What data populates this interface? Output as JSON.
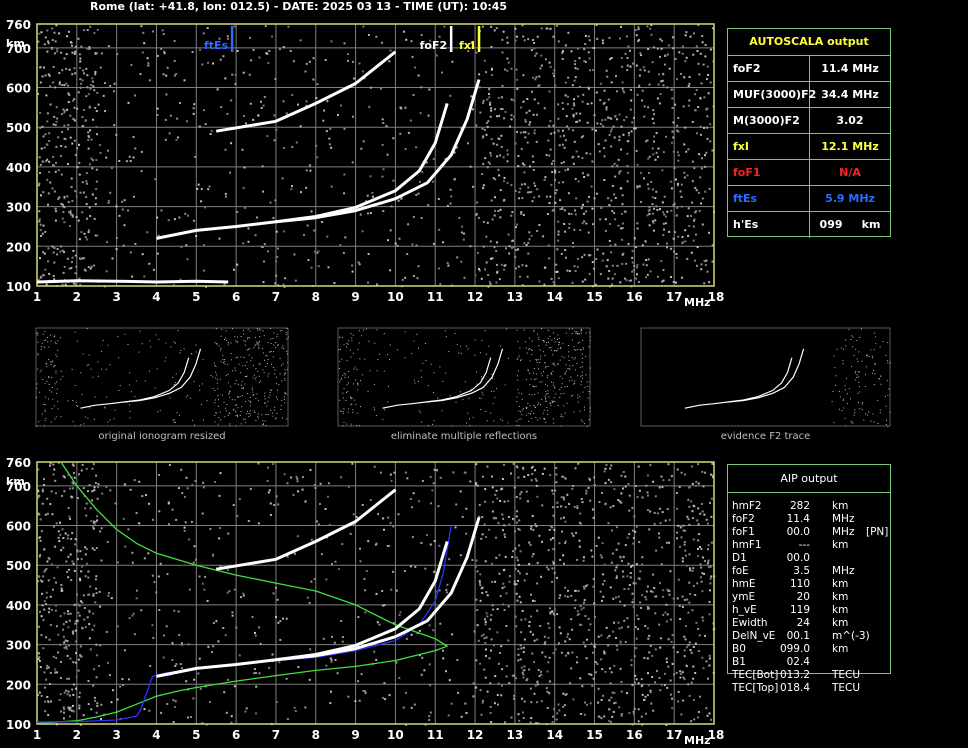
{
  "header": "Rome (lat: +41.8, lon: 012.5) - DATE: 2025 03 13 - TIME (UT): 10:45",
  "colors": {
    "grid": "#7f7f7f",
    "frame": "#d7d77a",
    "green": "#3fe03f",
    "blue": "#3030ff",
    "yellow": "#ffff3c",
    "red": "#ff2020",
    "es": "#2a6cff",
    "tblborder": "#7dc47d"
  },
  "chart_data": [
    {
      "type": "scatter",
      "title": "",
      "xlabel": "MHz",
      "ylabel": "km",
      "xlim": [
        1,
        18
      ],
      "ylim": [
        100,
        760
      ],
      "xticks": [
        "1",
        "2",
        "3",
        "4",
        "5",
        "6",
        "7",
        "8",
        "9",
        "10",
        "11",
        "12",
        "13",
        "14",
        "15",
        "16",
        "17",
        "18"
      ],
      "yticks": [
        "100",
        "200",
        "300",
        "400",
        "500",
        "600",
        "700",
        "760"
      ],
      "markers": [
        {
          "label": "ftEs",
          "x": 5.9,
          "color": "#2a6cff"
        },
        {
          "label": "foF2",
          "x": 11.4,
          "color": "#ffffff"
        },
        {
          "label": "fxI",
          "x": 12.1,
          "color": "#ffff3c"
        }
      ],
      "series": [
        {
          "values": [
            [
              4.0,
              220
            ],
            [
              5.0,
              240
            ],
            [
              6.0,
              250
            ],
            [
              7.0,
              262
            ],
            [
              8.0,
              275
            ],
            [
              9.0,
              298
            ],
            [
              10.0,
              340
            ],
            [
              10.6,
              390
            ],
            [
              11.0,
              460
            ],
            [
              11.3,
              560
            ]
          ],
          "color": "#ffffff"
        },
        {
          "values": [
            [
              7.0,
              262
            ],
            [
              8.0,
              272
            ],
            [
              9.0,
              290
            ],
            [
              10.0,
              320
            ],
            [
              10.8,
              360
            ],
            [
              11.4,
              430
            ],
            [
              11.8,
              520
            ],
            [
              12.1,
              620
            ]
          ],
          "color": "#ffffff"
        },
        {
          "values": [
            [
              5.5,
              490
            ],
            [
              7.0,
              515
            ],
            [
              8.0,
              560
            ],
            [
              9.0,
              610
            ],
            [
              10.0,
              690
            ]
          ],
          "color": "#ffffff"
        },
        {
          "values": [
            [
              1.0,
              110
            ],
            [
              2.0,
              113
            ],
            [
              3.0,
              112
            ],
            [
              4.0,
              110
            ],
            [
              5.0,
              112
            ],
            [
              5.8,
              110
            ]
          ],
          "color": "#ffffff"
        }
      ]
    },
    {
      "type": "line",
      "title": "",
      "xlabel": "MHz",
      "ylabel": "km",
      "xlim": [
        1,
        18
      ],
      "ylim": [
        100,
        760
      ],
      "xticks": [
        "1",
        "2",
        "3",
        "4",
        "5",
        "6",
        "7",
        "8",
        "9",
        "10",
        "11",
        "12",
        "13",
        "14",
        "15",
        "16",
        "17",
        "18"
      ],
      "yticks": [
        "100",
        "200",
        "300",
        "400",
        "500",
        "600",
        "700",
        "760"
      ],
      "series": [
        {
          "values": [
            [
              1.6,
              760
            ],
            [
              2.0,
              700
            ],
            [
              2.5,
              640
            ],
            [
              3.0,
              590
            ],
            [
              3.5,
              555
            ],
            [
              4.0,
              530
            ],
            [
              5.0,
              500
            ],
            [
              6.0,
              475
            ],
            [
              7.0,
              455
            ],
            [
              8.0,
              435
            ],
            [
              9.0,
              400
            ],
            [
              10.0,
              350
            ],
            [
              11.0,
              315
            ],
            [
              11.3,
              296
            ],
            [
              11.0,
              285
            ],
            [
              10.0,
              260
            ],
            [
              9.0,
              245
            ],
            [
              8.0,
              235
            ],
            [
              7.0,
              222
            ],
            [
              6.0,
              208
            ],
            [
              5.0,
              192
            ],
            [
              4.5,
              182
            ],
            [
              4.0,
              170
            ],
            [
              3.5,
              150
            ],
            [
              3.0,
              130
            ],
            [
              2.5,
              118
            ],
            [
              2.0,
              108
            ],
            [
              1.0,
              102
            ]
          ],
          "color": "#3fe03f"
        },
        {
          "values": [
            [
              1.0,
              105
            ],
            [
              2.0,
              106
            ],
            [
              3.0,
              110
            ],
            [
              3.5,
              120
            ],
            [
              3.6,
              135
            ],
            [
              3.9,
              220
            ],
            [
              4.2,
              228
            ],
            [
              5.0,
              240
            ],
            [
              6.0,
              250
            ],
            [
              7.0,
              260
            ],
            [
              8.0,
              268
            ],
            [
              9.0,
              285
            ],
            [
              10.0,
              310
            ],
            [
              10.6,
              350
            ],
            [
              11.0,
              410
            ],
            [
              11.2,
              480
            ],
            [
              11.4,
              600
            ]
          ],
          "color": "#3030ff"
        },
        {
          "values": [
            [
              4.0,
              220
            ],
            [
              5.0,
              240
            ],
            [
              6.0,
              250
            ],
            [
              7.0,
              262
            ],
            [
              8.0,
              275
            ],
            [
              9.0,
              298
            ],
            [
              10.0,
              340
            ],
            [
              10.6,
              390
            ],
            [
              11.0,
              460
            ],
            [
              11.3,
              560
            ]
          ],
          "color": "#ffffff"
        },
        {
          "values": [
            [
              7.0,
              262
            ],
            [
              8.0,
              272
            ],
            [
              9.0,
              290
            ],
            [
              10.0,
              320
            ],
            [
              10.8,
              360
            ],
            [
              11.4,
              430
            ],
            [
              11.8,
              520
            ],
            [
              12.1,
              620
            ]
          ],
          "color": "#ffffff"
        },
        {
          "values": [
            [
              5.5,
              490
            ],
            [
              7.0,
              515
            ],
            [
              8.0,
              560
            ],
            [
              9.0,
              610
            ],
            [
              10.0,
              690
            ]
          ],
          "color": "#ffffff"
        }
      ]
    }
  ],
  "thumbnails": [
    {
      "caption": "original ionogram resized"
    },
    {
      "caption": "eliminate multiple reflections"
    },
    {
      "caption": "evidence F2 trace"
    }
  ],
  "autoscala": {
    "title": "AUTOSCALA output",
    "rows": [
      {
        "k": "foF2",
        "v": "11.4 MHz",
        "kc": "#ffffff",
        "vc": "#ffffff"
      },
      {
        "k": "MUF(3000)F2",
        "v": "34.4 MHz",
        "kc": "#ffffff",
        "vc": "#ffffff"
      },
      {
        "k": "M(3000)F2",
        "v": "3.02",
        "kc": "#ffffff",
        "vc": "#ffffff"
      },
      {
        "k": "fxI",
        "v": "12.1 MHz",
        "kc": "#ffff3c",
        "vc": "#ffff3c"
      },
      {
        "k": "foF1",
        "v": "N/A",
        "kc": "#ff2020",
        "vc": "#ff2020"
      },
      {
        "k": "ftEs",
        "v": "5.9 MHz",
        "kc": "#2a6cff",
        "vc": "#2a6cff"
      },
      {
        "k": "h'Es",
        "v": "099     km",
        "kc": "#ffffff",
        "vc": "#ffffff"
      }
    ]
  },
  "aip": {
    "title": "AIP output",
    "rows": [
      {
        "n": "hmF2",
        "v": "282",
        "u": "km",
        "x": ""
      },
      {
        "n": "foF2",
        "v": "11.4",
        "u": "MHz",
        "x": ""
      },
      {
        "n": "foF1",
        "v": "00.0",
        "u": "MHz",
        "x": "[PN]"
      },
      {
        "n": "hmF1",
        "v": "---",
        "u": "km",
        "x": ""
      },
      {
        "n": "D1",
        "v": "00.0",
        "u": "",
        "x": ""
      },
      {
        "n": "foE",
        "v": "3.5",
        "u": "MHz",
        "x": ""
      },
      {
        "n": "hmE",
        "v": "110",
        "u": "km",
        "x": ""
      },
      {
        "n": "ymE",
        "v": "20",
        "u": "km",
        "x": ""
      },
      {
        "n": "h_vE",
        "v": "119",
        "u": "km",
        "x": ""
      },
      {
        "n": "Ewidth",
        "v": "24",
        "u": "km",
        "x": ""
      },
      {
        "n": "DelN_vE",
        "v": "00.1",
        "u": "m^(-3)",
        "x": ""
      },
      {
        "n": "B0",
        "v": "099.0",
        "u": "km",
        "x": ""
      },
      {
        "n": "B1",
        "v": "02.4",
        "u": "",
        "x": ""
      },
      {
        "n": "TEC[Bot]",
        "v": "013.2",
        "u": "TECU",
        "x": ""
      },
      {
        "n": "TEC[Top]",
        "v": "018.4",
        "u": "TECU",
        "x": ""
      }
    ]
  }
}
